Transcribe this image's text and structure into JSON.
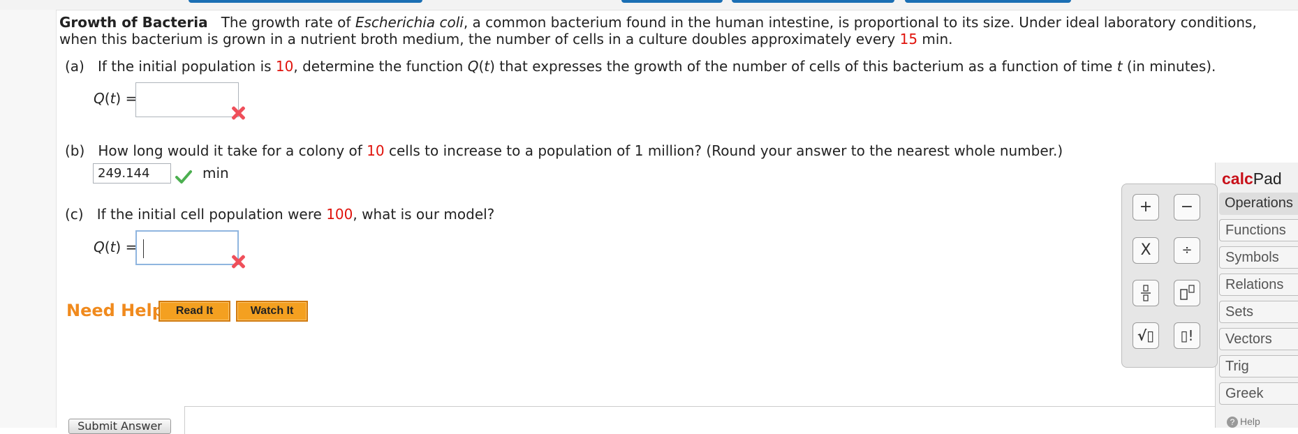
{
  "problem": {
    "title": "Growth of Bacteria",
    "intro_line1_a": "The growth rate of ",
    "intro_species": "Escherichia coli",
    "intro_line1_b": ", a common bacterium found in the human intestine, is proportional to its size. Under ideal laboratory conditions,",
    "intro_line2_a": "when this bacterium is grown in a nutrient broth medium, the number of cells in a culture doubles approximately every ",
    "doubling_time": "15",
    "intro_line2_b": " min."
  },
  "part_a": {
    "letter": "(a)",
    "text_1": "If the initial population is ",
    "initial_population": "10",
    "text_2": ", determine the function ",
    "func": "Q",
    "text_3": "(",
    "var": "t",
    "text_4": ") that expresses the growth of the number of cells of this bacterium as a function of time ",
    "var2": "t",
    "text_5": " (in minutes).",
    "label_q": "Q",
    "label_t": "t",
    "label_tail": ") =",
    "answer_value": ""
  },
  "part_b": {
    "letter": "(b)",
    "text_1": "How long would it take for a colony of ",
    "initial_cells": "10",
    "text_2": " cells to increase to a population of 1 million? (Round your answer to the nearest whole number.)",
    "answer_value": "249.144",
    "unit": "min"
  },
  "part_c": {
    "letter": "(c)",
    "text_1": "If the initial cell population were ",
    "initial_population": "100",
    "text_2": ", what is our model?",
    "label_q": "Q",
    "label_t": "t",
    "label_tail": ") =",
    "answer_value": ""
  },
  "help": {
    "need_help": "Need Help?",
    "read_it": "Read It",
    "watch_it": "Watch It"
  },
  "submit": {
    "label": "Submit Answer"
  },
  "calcpad": {
    "brand_bold": "calc",
    "brand_rest": "Pad",
    "buttons": {
      "plus": "+",
      "minus": "−",
      "times": "X",
      "divide": "÷",
      "sqrt": "√▯",
      "factorial": "▯!"
    },
    "tabs": [
      "Operations",
      "Functions",
      "Symbols",
      "Relations",
      "Sets",
      "Vectors",
      "Trig",
      "Greek"
    ],
    "help": "Help"
  },
  "colors": {
    "highlight_red": "#e0130c",
    "need_help_orange": "#f08a1d",
    "incorrect_x": "#ef4f5a",
    "correct_check": "#4caf50"
  }
}
